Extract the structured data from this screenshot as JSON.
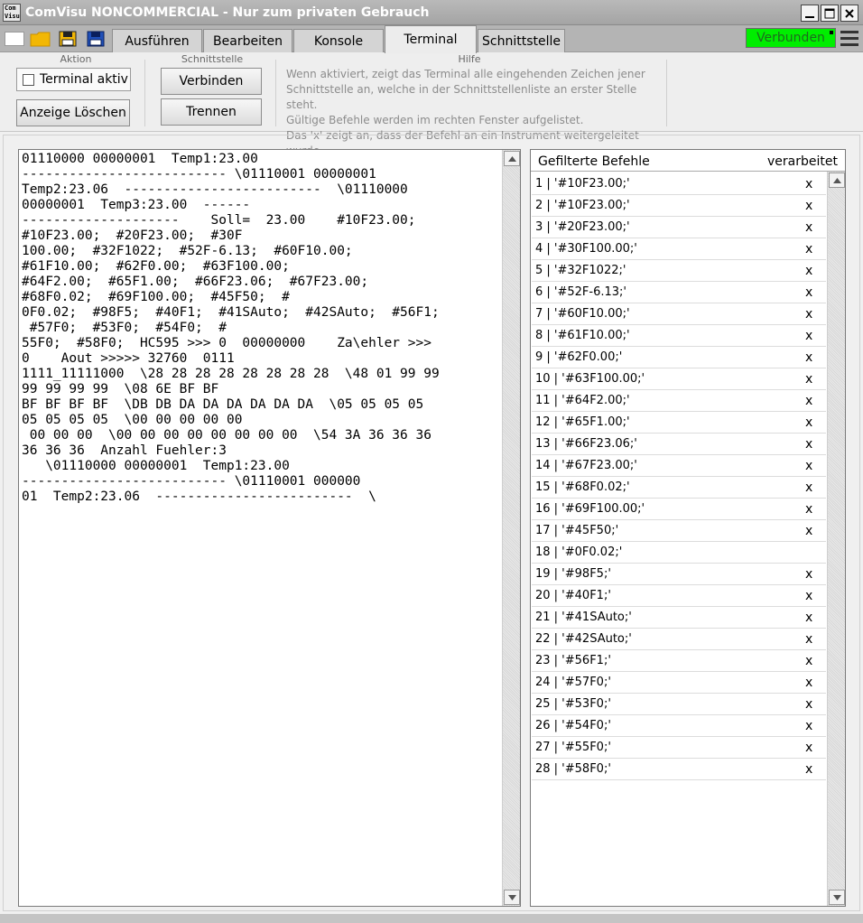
{
  "window": {
    "app_icon_text": "Com Visu",
    "title": "ComVisu NONCOMMERCIAL - Nur zum privaten Gebrauch"
  },
  "tabs": [
    {
      "label": "Ausführen",
      "active": false
    },
    {
      "label": "Bearbeiten",
      "active": false
    },
    {
      "label": "Konsole",
      "active": false
    },
    {
      "label": "Terminal",
      "active": true
    },
    {
      "label": "Schnittstelle",
      "active": false
    }
  ],
  "status": {
    "label": "Verbunden",
    "color": "#00ee00"
  },
  "ribbon": {
    "aktion": {
      "title": "Aktion",
      "terminal_aktiv_label": "Terminal aktiv",
      "terminal_aktiv_checked": false,
      "clear_label": "Anzeige Löschen"
    },
    "schnittstelle": {
      "title": "Schnittstelle",
      "connect_label": "Verbinden",
      "disconnect_label": "Trennen"
    },
    "hilfe": {
      "title": "Hilfe",
      "lines": [
        "Wenn aktiviert, zeigt das Terminal alle eingehenden Zeichen jener",
        "Schnittstelle an, welche in der Schnittstellenliste an erster Stelle steht.",
        "Gültige Befehle werden im rechten Fenster aufgelistet.",
        "Das 'x' zeigt an, dass der Befehl an ein Instrument weitergeleitet wurde."
      ]
    }
  },
  "terminal": {
    "lines": [
      "01110000 00000001  Temp1:23.00",
      "-------------------------- \\01110001 00000001",
      "Temp2:23.06  -------------------------  \\01110000",
      "00000001  Temp3:23.00  ------",
      "--------------------    Soll=  23.00    #10F23.00;",
      "#10F23.00;  #20F23.00;  #30F",
      "100.00;  #32F1022;  #52F-6.13;  #60F10.00;",
      "#61F10.00;  #62F0.00;  #63F100.00;",
      "#64F2.00;  #65F1.00;  #66F23.06;  #67F23.00;",
      "#68F0.02;  #69F100.00;  #45F50;  #",
      "0F0.02;  #98F5;  #40F1;  #41SAuto;  #42SAuto;  #56F1;",
      " #57F0;  #53F0;  #54F0;  #",
      "55F0;  #58F0;  HC595 >>> 0  00000000    Za\\ehler >>>",
      "0    Aout >>>>> 32760  0111",
      "1111_11111000  \\28 28 28 28 28 28 28 28  \\48 01 99 99",
      "99 99 99 99  \\08 6E BF BF",
      "BF BF BF BF  \\DB DB DA DA DA DA DA DA  \\05 05 05 05",
      "05 05 05 05  \\00 00 00 00 00",
      " 00 00 00  \\00 00 00 00 00 00 00 00  \\54 3A 36 36 36",
      "36 36 36  Anzahl Fuehler:3",
      "   \\01110000 00000001  Temp1:23.00",
      "-------------------------- \\01110001 000000",
      "01  Temp2:23.06  -------------------------  \\"
    ]
  },
  "filtered": {
    "header_left": "Gefilterte Befehle",
    "header_right": "verarbeitet",
    "rows": [
      {
        "text": "1 | '#10F23.00;'",
        "mark": "x"
      },
      {
        "text": "2 | '#10F23.00;'",
        "mark": "x"
      },
      {
        "text": "3 | '#20F23.00;'",
        "mark": "x"
      },
      {
        "text": "4 | '#30F100.00;'",
        "mark": "x"
      },
      {
        "text": "5 | '#32F1022;'",
        "mark": "x"
      },
      {
        "text": "6 | '#52F-6.13;'",
        "mark": "x"
      },
      {
        "text": "7 | '#60F10.00;'",
        "mark": "x"
      },
      {
        "text": "8 | '#61F10.00;'",
        "mark": "x"
      },
      {
        "text": "9 | '#62F0.00;'",
        "mark": "x"
      },
      {
        "text": "10 | '#63F100.00;'",
        "mark": "x"
      },
      {
        "text": "11 | '#64F2.00;'",
        "mark": "x"
      },
      {
        "text": "12 | '#65F1.00;'",
        "mark": "x"
      },
      {
        "text": "13 | '#66F23.06;'",
        "mark": "x"
      },
      {
        "text": "14 | '#67F23.00;'",
        "mark": "x"
      },
      {
        "text": "15 | '#68F0.02;'",
        "mark": "x"
      },
      {
        "text": "16 | '#69F100.00;'",
        "mark": "x"
      },
      {
        "text": "17 | '#45F50;'",
        "mark": "x"
      },
      {
        "text": "18 | '#0F0.02;'",
        "mark": ""
      },
      {
        "text": "19 | '#98F5;'",
        "mark": "x"
      },
      {
        "text": "20 | '#40F1;'",
        "mark": "x"
      },
      {
        "text": "21 | '#41SAuto;'",
        "mark": "x"
      },
      {
        "text": "22 | '#42SAuto;'",
        "mark": "x"
      },
      {
        "text": "23 | '#56F1;'",
        "mark": "x"
      },
      {
        "text": "24 | '#57F0;'",
        "mark": "x"
      },
      {
        "text": "25 | '#53F0;'",
        "mark": "x"
      },
      {
        "text": "26 | '#54F0;'",
        "mark": "x"
      },
      {
        "text": "27 | '#55F0;'",
        "mark": "x"
      },
      {
        "text": "28 | '#58F0;'",
        "mark": "x"
      }
    ]
  }
}
